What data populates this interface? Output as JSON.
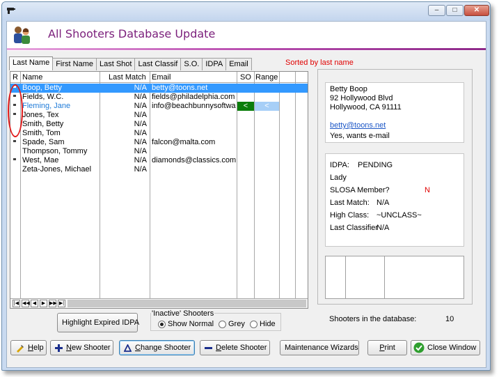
{
  "app": {
    "title": "All Shooters Database Update",
    "accent": "#7b1f7b",
    "window_controls": [
      "minimize",
      "maximize",
      "close"
    ]
  },
  "tabs": [
    {
      "label": "Last Name",
      "active": true
    },
    {
      "label": "First Name",
      "active": false
    },
    {
      "label": "Last Shot",
      "active": false
    },
    {
      "label": "Last Classif",
      "active": false
    },
    {
      "label": "S.O.",
      "active": false
    },
    {
      "label": "IDPA",
      "active": false
    },
    {
      "label": "Email",
      "active": false
    }
  ],
  "sorted_note": "Sorted by last name",
  "grid": {
    "headers": {
      "r": "R",
      "name": "Name",
      "last_match": "Last Match",
      "email": "Email",
      "so": "SO",
      "range": "Range"
    },
    "rows": [
      {
        "name": "Boop, Betty",
        "last_match": "N/A",
        "email": "betty@toons.net",
        "r_mark": true,
        "selected": true,
        "so": "",
        "range": ""
      },
      {
        "name": "Fields, W.C.",
        "last_match": "N/A",
        "email": "fields@philadelphia.com",
        "r_mark": true,
        "selected": false,
        "so": "",
        "range": ""
      },
      {
        "name": "Fleming, Jane",
        "last_match": "N/A",
        "email": "info@beachbunnysoftware",
        "r_mark": true,
        "selected": false,
        "so": "<",
        "range": "<"
      },
      {
        "name": "Jones, Tex",
        "last_match": "N/A",
        "email": "",
        "r_mark": true,
        "selected": false,
        "so": "",
        "range": ""
      },
      {
        "name": "Smith, Betty",
        "last_match": "N/A",
        "email": "",
        "r_mark": false,
        "selected": false,
        "so": "",
        "range": ""
      },
      {
        "name": "Smith, Tom",
        "last_match": "N/A",
        "email": "",
        "r_mark": false,
        "selected": false,
        "so": "",
        "range": ""
      },
      {
        "name": "Spade, Sam",
        "last_match": "N/A",
        "email": "falcon@malta.com",
        "r_mark": true,
        "selected": false,
        "so": "",
        "range": ""
      },
      {
        "name": "Thompson, Tommy",
        "last_match": "N/A",
        "email": "",
        "r_mark": false,
        "selected": false,
        "so": "",
        "range": ""
      },
      {
        "name": "West, Mae",
        "last_match": "N/A",
        "email": "diamonds@classics.com",
        "r_mark": true,
        "selected": false,
        "so": "",
        "range": ""
      },
      {
        "name": "Zeta-Jones, Michael",
        "last_match": "N/A",
        "email": "",
        "r_mark": false,
        "selected": false,
        "so": "",
        "range": ""
      }
    ],
    "nav_buttons": [
      "first",
      "prev-page",
      "prev",
      "next",
      "next-page",
      "last"
    ]
  },
  "details": {
    "address": {
      "name": "Betty  Boop",
      "street": "92 Hollywood Blvd",
      "city": "Hollywood, CA  91111",
      "email": "betty@toons.net",
      "email_pref": "Yes, wants e-mail"
    },
    "stats": {
      "idpa_label": "IDPA:",
      "idpa_value": "PENDING",
      "gender": "Lady",
      "slosa_label": "SLOSA Member?",
      "slosa_value": "N",
      "last_match_label": "Last Match:",
      "last_match_value": "N/A",
      "high_class_label": "High Class:",
      "high_class_value": "~UNCLASS~",
      "last_classifier_label": "Last Classifier",
      "last_classifier_value": "N/A"
    }
  },
  "highlight_button": "Highlight  Expired IDPA",
  "inactive": {
    "title": "'Inactive' Shooters",
    "options": [
      {
        "label": "Show Normal",
        "selected": true
      },
      {
        "label": "Grey",
        "selected": false
      },
      {
        "label": "Hide",
        "selected": false
      }
    ]
  },
  "count": {
    "label": "Shooters in the database:",
    "value": "10"
  },
  "buttons": {
    "help": {
      "label": "Help",
      "ul": "H",
      "rest": "elp"
    },
    "new": {
      "label": "New Shooter",
      "ul": "N",
      "rest": "ew Shooter"
    },
    "change": {
      "label": "Change Shooter",
      "ul": "C",
      "rest": "hange Shooter"
    },
    "delete": {
      "label": "Delete Shooter",
      "ul": "D",
      "rest": "elete Shooter"
    },
    "wizards": {
      "label": "Maintenance Wizards"
    },
    "print": {
      "label": "Print",
      "ul": "P",
      "rest": "rint"
    },
    "close": {
      "label": "Close Window"
    }
  }
}
